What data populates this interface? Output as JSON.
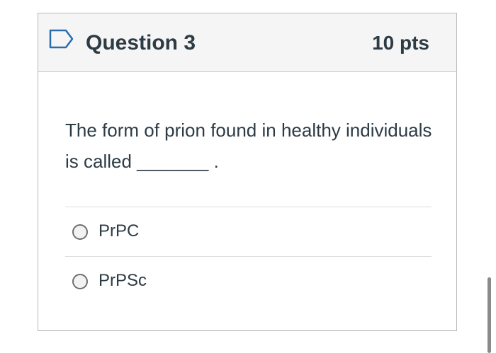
{
  "question": {
    "title": "Question 3",
    "points": "10 pts",
    "flag_icon": "flag-outline-icon",
    "text": "The form of prion found in healthy individuals is called _______ .",
    "answers": [
      {
        "label": "PrPC",
        "selected": false
      },
      {
        "label": "PrPSc",
        "selected": false
      }
    ]
  },
  "colors": {
    "header_bg": "#f5f5f5",
    "text": "#2d3b45",
    "flag": "#2b6cb0"
  }
}
